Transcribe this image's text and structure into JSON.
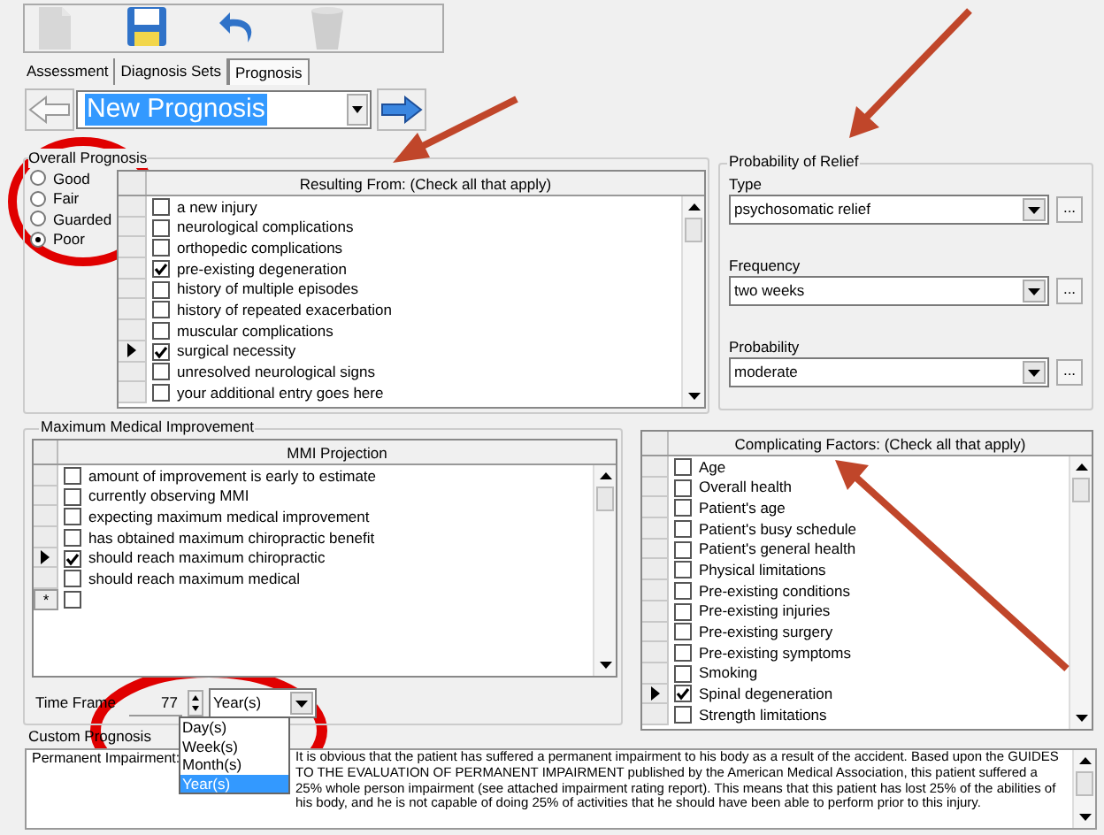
{
  "toolbar": [
    {
      "kind": "new",
      "disabled": true
    },
    {
      "kind": "save",
      "disabled": false
    },
    {
      "kind": "undo",
      "disabled": false
    },
    {
      "kind": "delete",
      "disabled": true
    }
  ],
  "tabs": [
    {
      "label": "Assessment",
      "selected": false
    },
    {
      "label": "Diagnosis Sets",
      "selected": false
    },
    {
      "label": "Prognosis",
      "selected": true
    }
  ],
  "navigator": {
    "value": "New Prognosis"
  },
  "overall_prognosis": {
    "title": "Overall Prognosis",
    "options": [
      {
        "label": "Good",
        "selected": false
      },
      {
        "label": "Fair",
        "selected": false
      },
      {
        "label": "Guarded",
        "selected": false
      },
      {
        "label": "Poor",
        "selected": true
      }
    ]
  },
  "resulting_from": {
    "header": "Resulting From:  (Check all that apply)",
    "rows": [
      {
        "label": "a new injury",
        "checked": false,
        "current": false
      },
      {
        "label": "neurological complications",
        "checked": false,
        "current": false
      },
      {
        "label": "orthopedic complications",
        "checked": false,
        "current": false
      },
      {
        "label": "pre-existing degeneration",
        "checked": true,
        "current": false
      },
      {
        "label": "history of multiple episodes",
        "checked": false,
        "current": false
      },
      {
        "label": "history of repeated exacerbation",
        "checked": false,
        "current": false
      },
      {
        "label": "muscular complications",
        "checked": false,
        "current": false
      },
      {
        "label": "surgical necessity",
        "checked": true,
        "current": true
      },
      {
        "label": "unresolved neurological signs",
        "checked": false,
        "current": false
      },
      {
        "label": "your additional entry goes here",
        "checked": false,
        "current": false
      }
    ]
  },
  "probability_of_relief": {
    "title": "Probability of Relief",
    "fields": [
      {
        "label": "Type",
        "value": "psychosomatic relief",
        "more": "..."
      },
      {
        "label": "Frequency",
        "value": "two weeks",
        "more": "..."
      },
      {
        "label": "Probability",
        "value": "moderate",
        "more": "..."
      }
    ]
  },
  "maximum_medical_improvement": {
    "title": "Maximum Medical Improvement",
    "header": "MMI Projection",
    "rows": [
      {
        "label": "amount of improvement is early to estimate",
        "checked": false,
        "current": false
      },
      {
        "label": "currently observing MMI",
        "checked": false,
        "current": false
      },
      {
        "label": "expecting maximum medical improvement",
        "checked": false,
        "current": false
      },
      {
        "label": "has obtained maximum chiropractic benefit",
        "checked": false,
        "current": false
      },
      {
        "label": "should reach maximum chiropractic",
        "checked": true,
        "current": true
      },
      {
        "label": "should reach maximum medical",
        "checked": false,
        "current": false
      }
    ],
    "new_row": {
      "marker": "*",
      "checked": false
    },
    "time_frame": {
      "label": "Time Frame",
      "value": "77",
      "unit": "Year(s)",
      "options": [
        {
          "label": "Day(s)",
          "selected": false
        },
        {
          "label": "Week(s)",
          "selected": false
        },
        {
          "label": "Month(s)",
          "selected": false
        },
        {
          "label": "Year(s)",
          "selected": true
        }
      ]
    }
  },
  "complicating_factors": {
    "header": "Complicating Factors: (Check all that apply)",
    "rows": [
      {
        "label": "Age",
        "checked": false,
        "current": false
      },
      {
        "label": "Overall health",
        "checked": false,
        "current": false
      },
      {
        "label": "Patient's age",
        "checked": false,
        "current": false
      },
      {
        "label": "Patient's busy schedule",
        "checked": false,
        "current": false
      },
      {
        "label": "Patient's general health",
        "checked": false,
        "current": false
      },
      {
        "label": "Physical limitations",
        "checked": false,
        "current": false
      },
      {
        "label": "Pre-existing conditions",
        "checked": false,
        "current": false
      },
      {
        "label": "Pre-existing injuries",
        "checked": false,
        "current": false
      },
      {
        "label": "Pre-existing surgery",
        "checked": false,
        "current": false
      },
      {
        "label": "Pre-existing symptoms",
        "checked": false,
        "current": false
      },
      {
        "label": "Smoking",
        "checked": false,
        "current": false
      },
      {
        "label": "Spinal degeneration",
        "checked": true,
        "current": true
      },
      {
        "label": "Strength limitations",
        "checked": false,
        "current": false
      }
    ]
  },
  "custom_prognosis": {
    "label": "Custom Prognosis",
    "heading": "Permanent Impairment:",
    "text": "It is obvious that the patient has suffered a permanent impairment to his body as a result of the accident. Based upon the GUIDES TO THE EVALUATION OF PERMANENT IMPAIRMENT published by the American Medical Association, this patient suffered a 25% whole person impairment (see attached impairment rating report). This means that this patient has lost 25% of the abilities of his body, and he is not capable of doing 25% of activities that he should have been able to perform prior to this injury."
  }
}
